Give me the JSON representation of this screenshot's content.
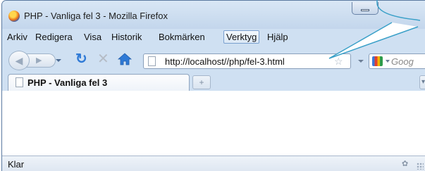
{
  "window": {
    "title": "PHP - Vanliga fel 3 - Mozilla Firefox"
  },
  "menubar": {
    "items": [
      {
        "label": "Arkiv"
      },
      {
        "label": "Redigera"
      },
      {
        "label": "Visa"
      },
      {
        "label": "Historik"
      },
      {
        "label": "Bokmärken"
      },
      {
        "label": "Verktyg",
        "highlighted": true
      },
      {
        "label": "Hjälp"
      }
    ]
  },
  "navigation": {
    "url": "http://localhost//php/fel-3.html",
    "search_placeholder": "Goog"
  },
  "tabs": [
    {
      "label": "PHP - Vanliga fel 3",
      "active": true
    }
  ],
  "new_tab_symbol": "+",
  "status": {
    "text": "Klar"
  },
  "icons": {
    "app": "firefox-icon",
    "back": "back-arrow-icon",
    "forward": "forward-arrow-icon",
    "reload": "reload-icon",
    "stop": "stop-icon",
    "home": "home-icon",
    "page": "page-icon",
    "bookmark": "star-icon",
    "search_engine": "google-icon",
    "search": "search-icon"
  },
  "colors": {
    "chrome": "#cfe0f2",
    "reload": "#2f7ad6",
    "home": "#2f7ad6",
    "callout_stroke": "#3aa0c8"
  }
}
